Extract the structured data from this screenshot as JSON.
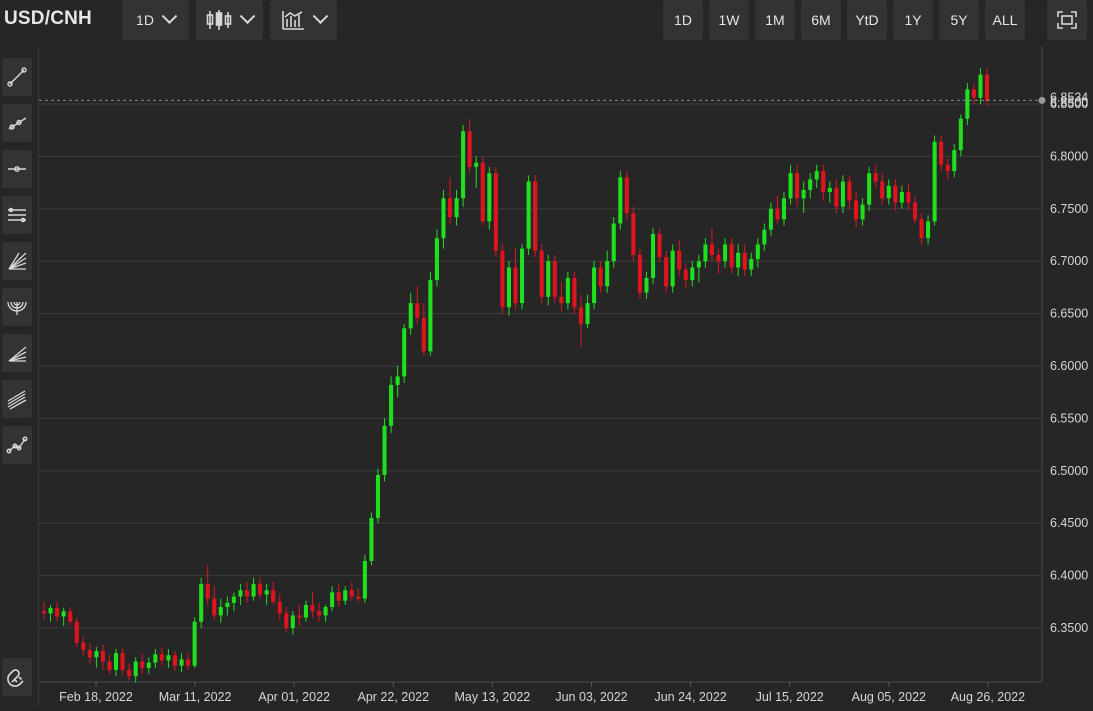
{
  "header": {
    "symbol": "USD/CNH",
    "interval_label": "1D",
    "candle_icon": "candlestick-icon",
    "indicator_icon": "indicator-chart-icon",
    "ranges": [
      "1D",
      "1W",
      "1M",
      "6M",
      "YtD",
      "1Y",
      "5Y",
      "ALL"
    ],
    "fullscreen_icon": "fullscreen-icon"
  },
  "sidebar": {
    "tools": [
      "trend-line-icon",
      "ray-line-icon",
      "horizontal-line-icon",
      "parallel-channel-icon",
      "gann-fan-icon",
      "fibonacci-arc-icon",
      "fibonacci-fan-icon",
      "regression-channel-icon",
      "path-tool-icon"
    ],
    "bottom_tool": "magnet-icon"
  },
  "colors": {
    "up": "#1ee01e",
    "down": "#e0141e",
    "background": "#262626",
    "grid": "#3c3c3c",
    "text": "#d6d6d6"
  },
  "chart_data": {
    "type": "candlestick",
    "title": "",
    "grid": true,
    "ylim": [
      6.3,
      6.89
    ],
    "yticks": [
      "6.3500",
      "6.4000",
      "6.4500",
      "6.5000",
      "6.5500",
      "6.6000",
      "6.6500",
      "6.7000",
      "6.7500",
      "6.8000",
      "6.8500"
    ],
    "xticks": [
      "Feb 18, 2022",
      "Mar 11, 2022",
      "Apr 01, 2022",
      "Apr 22, 2022",
      "May 13, 2022",
      "Jun 03, 2022",
      "Jun 24, 2022",
      "Jul 15, 2022",
      "Aug 05, 2022",
      "Aug 26, 2022"
    ],
    "last_price_labels": [
      "6.8534",
      "6.8500"
    ],
    "candles": [
      [
        6.366,
        6.375,
        6.358,
        6.364
      ],
      [
        6.364,
        6.372,
        6.356,
        6.369
      ],
      [
        6.369,
        6.375,
        6.356,
        6.361
      ],
      [
        6.361,
        6.369,
        6.352,
        6.366
      ],
      [
        6.366,
        6.37,
        6.352,
        6.356
      ],
      [
        6.356,
        6.36,
        6.332,
        6.336
      ],
      [
        6.336,
        6.342,
        6.324,
        6.329
      ],
      [
        6.329,
        6.335,
        6.316,
        6.322
      ],
      [
        6.322,
        6.332,
        6.312,
        6.328
      ],
      [
        6.328,
        6.334,
        6.31,
        6.318
      ],
      [
        6.318,
        6.324,
        6.306,
        6.31
      ],
      [
        6.31,
        6.33,
        6.304,
        6.326
      ],
      [
        6.326,
        6.332,
        6.306,
        6.31
      ],
      [
        6.31,
        6.316,
        6.3,
        6.304
      ],
      [
        6.304,
        6.322,
        6.298,
        6.318
      ],
      [
        6.318,
        6.326,
        6.306,
        6.312
      ],
      [
        6.312,
        6.322,
        6.306,
        6.317
      ],
      [
        6.317,
        6.33,
        6.312,
        6.325
      ],
      [
        6.325,
        6.332,
        6.314,
        6.319
      ],
      [
        6.319,
        6.33,
        6.312,
        6.324
      ],
      [
        6.324,
        6.328,
        6.309,
        6.314
      ],
      [
        6.314,
        6.326,
        6.308,
        6.32
      ],
      [
        6.32,
        6.326,
        6.31,
        6.314
      ],
      [
        6.314,
        6.36,
        6.312,
        6.356
      ],
      [
        6.356,
        6.398,
        6.35,
        6.392
      ],
      [
        6.392,
        6.41,
        6.372,
        6.378
      ],
      [
        6.378,
        6.39,
        6.358,
        6.362
      ],
      [
        6.362,
        6.378,
        6.355,
        6.37
      ],
      [
        6.37,
        6.38,
        6.362,
        6.374
      ],
      [
        6.374,
        6.384,
        6.366,
        6.38
      ],
      [
        6.38,
        6.392,
        6.372,
        6.386
      ],
      [
        6.386,
        6.394,
        6.374,
        6.38
      ],
      [
        6.38,
        6.398,
        6.376,
        6.392
      ],
      [
        6.392,
        6.398,
        6.378,
        6.382
      ],
      [
        6.382,
        6.392,
        6.372,
        6.386
      ],
      [
        6.386,
        6.394,
        6.372,
        6.375
      ],
      [
        6.375,
        6.382,
        6.358,
        6.364
      ],
      [
        6.364,
        6.37,
        6.346,
        6.35
      ],
      [
        6.35,
        6.366,
        6.344,
        6.362
      ],
      [
        6.362,
        6.372,
        6.352,
        6.36
      ],
      [
        6.36,
        6.376,
        6.356,
        6.372
      ],
      [
        6.372,
        6.384,
        6.36,
        6.366
      ],
      [
        6.366,
        6.374,
        6.356,
        6.362
      ],
      [
        6.362,
        6.372,
        6.356,
        6.37
      ],
      [
        6.37,
        6.39,
        6.366,
        6.384
      ],
      [
        6.384,
        6.392,
        6.37,
        6.376
      ],
      [
        6.376,
        6.39,
        6.372,
        6.386
      ],
      [
        6.386,
        6.394,
        6.376,
        6.38
      ],
      [
        6.38,
        6.388,
        6.374,
        6.378
      ],
      [
        6.378,
        6.42,
        6.374,
        6.414
      ],
      [
        6.414,
        6.46,
        6.41,
        6.455
      ],
      [
        6.455,
        6.502,
        6.45,
        6.496
      ],
      [
        6.496,
        6.55,
        6.49,
        6.543
      ],
      [
        6.543,
        6.59,
        6.536,
        6.582
      ],
      [
        6.582,
        6.6,
        6.57,
        6.59
      ],
      [
        6.59,
        6.64,
        6.584,
        6.636
      ],
      [
        6.636,
        6.67,
        6.63,
        6.66
      ],
      [
        6.66,
        6.676,
        6.64,
        6.646
      ],
      [
        6.646,
        6.66,
        6.61,
        6.614
      ],
      [
        6.614,
        6.69,
        6.61,
        6.682
      ],
      [
        6.682,
        6.73,
        6.676,
        6.722
      ],
      [
        6.722,
        6.768,
        6.712,
        6.76
      ],
      [
        6.76,
        6.78,
        6.736,
        6.742
      ],
      [
        6.742,
        6.768,
        6.734,
        6.76
      ],
      [
        6.76,
        6.83,
        6.752,
        6.824
      ],
      [
        6.824,
        6.836,
        6.784,
        6.79
      ],
      [
        6.79,
        6.8,
        6.77,
        6.794
      ],
      [
        6.794,
        6.8,
        6.734,
        6.738
      ],
      [
        6.738,
        6.79,
        6.73,
        6.784
      ],
      [
        6.784,
        6.79,
        6.704,
        6.71
      ],
      [
        6.71,
        6.716,
        6.65,
        6.656
      ],
      [
        6.656,
        6.7,
        6.648,
        6.694
      ],
      [
        6.694,
        6.712,
        6.654,
        6.66
      ],
      [
        6.66,
        6.716,
        6.654,
        6.712
      ],
      [
        6.712,
        6.782,
        6.706,
        6.776
      ],
      [
        6.776,
        6.782,
        6.704,
        6.71
      ],
      [
        6.71,
        6.716,
        6.66,
        6.666
      ],
      [
        6.666,
        6.706,
        6.658,
        6.7
      ],
      [
        6.7,
        6.706,
        6.66,
        6.666
      ],
      [
        6.666,
        6.68,
        6.652,
        6.66
      ],
      [
        6.66,
        6.69,
        6.654,
        6.684
      ],
      [
        6.684,
        6.69,
        6.65,
        6.656
      ],
      [
        6.656,
        6.668,
        6.618,
        6.64
      ],
      [
        6.64,
        6.668,
        6.636,
        6.66
      ],
      [
        6.66,
        6.7,
        6.654,
        6.694
      ],
      [
        6.694,
        6.7,
        6.67,
        6.676
      ],
      [
        6.676,
        6.71,
        6.67,
        6.7
      ],
      [
        6.7,
        6.742,
        6.694,
        6.736
      ],
      [
        6.736,
        6.786,
        6.73,
        6.78
      ],
      [
        6.78,
        6.786,
        6.74,
        6.746
      ],
      [
        6.746,
        6.752,
        6.7,
        6.706
      ],
      [
        6.706,
        6.712,
        6.664,
        6.67
      ],
      [
        6.67,
        6.69,
        6.664,
        6.684
      ],
      [
        6.684,
        6.732,
        6.678,
        6.726
      ],
      [
        6.726,
        6.732,
        6.7,
        6.704
      ],
      [
        6.704,
        6.71,
        6.67,
        6.676
      ],
      [
        6.676,
        6.716,
        6.67,
        6.71
      ],
      [
        6.71,
        6.72,
        6.686,
        6.692
      ],
      [
        6.692,
        6.698,
        6.674,
        6.682
      ],
      [
        6.682,
        6.7,
        6.676,
        6.694
      ],
      [
        6.694,
        6.706,
        6.68,
        6.7
      ],
      [
        6.7,
        6.722,
        6.694,
        6.716
      ],
      [
        6.716,
        6.732,
        6.7,
        6.706
      ],
      [
        6.706,
        6.712,
        6.688,
        6.7
      ],
      [
        6.7,
        6.722,
        6.694,
        6.716
      ],
      [
        6.716,
        6.722,
        6.688,
        6.694
      ],
      [
        6.694,
        6.716,
        6.686,
        6.708
      ],
      [
        6.708,
        6.716,
        6.686,
        6.692
      ],
      [
        6.692,
        6.708,
        6.686,
        6.702
      ],
      [
        6.702,
        6.722,
        6.694,
        6.716
      ],
      [
        6.716,
        6.736,
        6.71,
        6.73
      ],
      [
        6.73,
        6.756,
        6.724,
        6.75
      ],
      [
        6.75,
        6.762,
        6.736,
        6.74
      ],
      [
        6.74,
        6.766,
        6.734,
        6.76
      ],
      [
        6.76,
        6.792,
        6.754,
        6.784
      ],
      [
        6.784,
        6.792,
        6.752,
        6.76
      ],
      [
        6.76,
        6.776,
        6.746,
        6.768
      ],
      [
        6.768,
        6.784,
        6.76,
        6.778
      ],
      [
        6.778,
        6.792,
        6.77,
        6.786
      ],
      [
        6.786,
        6.792,
        6.758,
        6.766
      ],
      [
        6.766,
        6.776,
        6.756,
        6.77
      ],
      [
        6.77,
        6.778,
        6.746,
        6.752
      ],
      [
        6.752,
        6.782,
        6.746,
        6.776
      ],
      [
        6.776,
        6.782,
        6.75,
        6.758
      ],
      [
        6.758,
        6.766,
        6.732,
        6.74
      ],
      [
        6.74,
        6.76,
        6.734,
        6.754
      ],
      [
        6.754,
        6.79,
        6.748,
        6.784
      ],
      [
        6.784,
        6.792,
        6.77,
        6.776
      ],
      [
        6.776,
        6.784,
        6.754,
        6.76
      ],
      [
        6.76,
        6.778,
        6.754,
        6.772
      ],
      [
        6.772,
        6.778,
        6.748,
        6.756
      ],
      [
        6.756,
        6.772,
        6.75,
        6.766
      ],
      [
        6.766,
        6.774,
        6.748,
        6.756
      ],
      [
        6.756,
        6.762,
        6.736,
        6.74
      ],
      [
        6.74,
        6.746,
        6.716,
        6.722
      ],
      [
        6.722,
        6.744,
        6.716,
        6.738
      ],
      [
        6.738,
        6.82,
        6.734,
        6.814
      ],
      [
        6.814,
        6.82,
        6.786,
        6.792
      ],
      [
        6.792,
        6.798,
        6.778,
        6.786
      ],
      [
        6.786,
        6.812,
        6.78,
        6.806
      ],
      [
        6.806,
        6.84,
        6.8,
        6.836
      ],
      [
        6.836,
        6.87,
        6.83,
        6.864
      ],
      [
        6.864,
        6.87,
        6.85,
        6.856
      ],
      [
        6.856,
        6.884,
        6.85,
        6.878
      ],
      [
        6.878,
        6.884,
        6.848,
        6.853
      ]
    ]
  }
}
